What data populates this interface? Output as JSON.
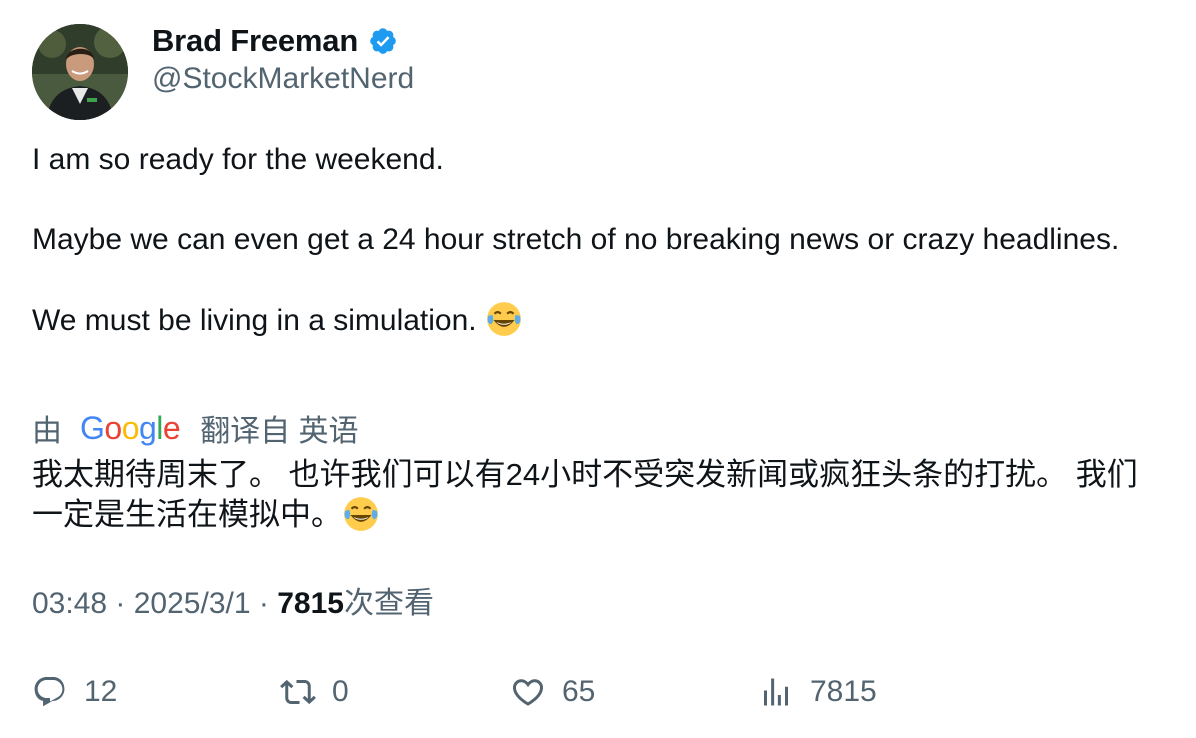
{
  "author": {
    "display_name": "Brad Freeman",
    "handle": "@StockMarketNerd",
    "verified": true
  },
  "tweet": {
    "line1": "I am so ready for the weekend.",
    "line2": "Maybe we can even get a 24 hour stretch of no breaking news or crazy headlines.",
    "line3": "We must be living in a simulation.",
    "emoji": "face-with-tears-of-joy"
  },
  "translation": {
    "prefix": "由",
    "provider": "Google",
    "suffix": "翻译自 英语",
    "text": "我太期待周末了。 也许我们可以有24小时不受突发新闻或疯狂头条的打扰。 我们一定是生活在模拟中。"
  },
  "meta": {
    "time": "03:48",
    "sep1": " · ",
    "date": "2025/3/1",
    "sep2": " · ",
    "views": "7815",
    "views_suffix": "次查看"
  },
  "actions": {
    "replies": "12",
    "reposts": "0",
    "likes": "65",
    "views": "7815"
  },
  "colors": {
    "text": "#0f1419",
    "secondary": "#536471",
    "verified": "#1d9bf0"
  }
}
